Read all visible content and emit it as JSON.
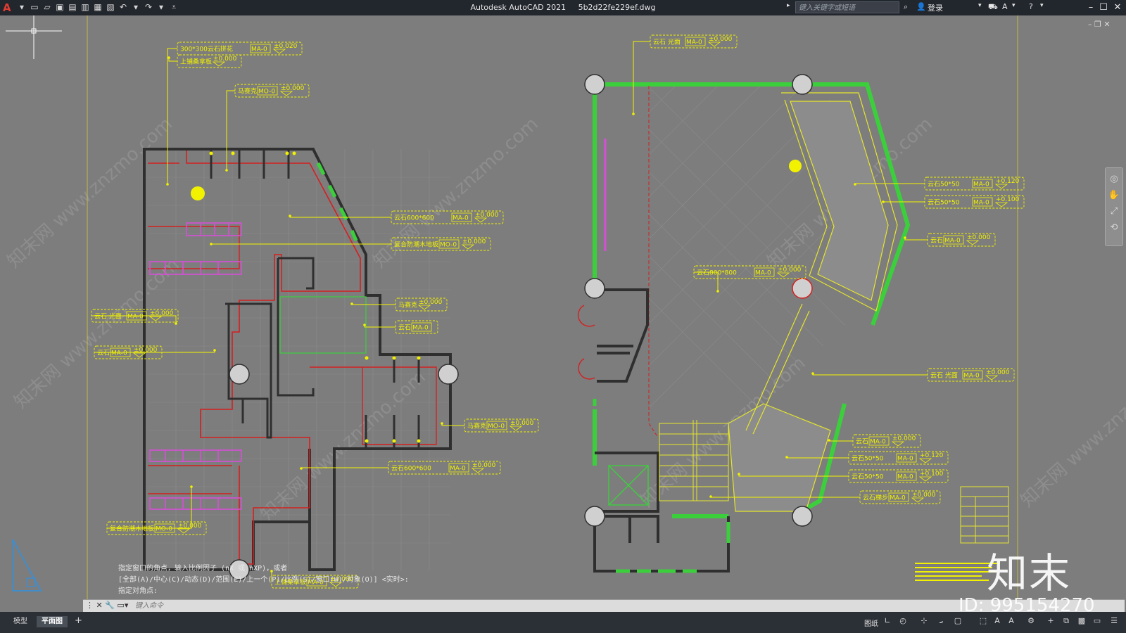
{
  "titlebar": {
    "app_name": "Autodesk AutoCAD 2021",
    "file_name": "5b2d22fe229ef.dwg",
    "search_placeholder": "键入关键字或短语",
    "login_label": "登录",
    "help_label": "?"
  },
  "command": {
    "history": [
      "指定窗口的角点，输入比例因子 (nX 或 nXP)，或者",
      "[全部(A)/中心(C)/动态(D)/范围(E)/上一个(P)/比例(S)/窗口(W)/对象(O)] <实时>:",
      "指定对角点:"
    ],
    "input_placeholder": "键入命令"
  },
  "status": {
    "tabs": [
      "模型",
      "平面图"
    ],
    "active_tab": "平面图",
    "add_tab": "+",
    "paper_label": "图纸"
  },
  "annotations": {
    "left": [
      {
        "text": "300*300云石拼花",
        "tag": "MA-0",
        "level": "±0.020"
      },
      {
        "text": "上铺桑拿板",
        "tag": "",
        "level": "±0.000"
      },
      {
        "text": "马赛克",
        "tag": "MO-0",
        "level": "±0.000"
      },
      {
        "text": "云石600*600",
        "tag": "MA-0",
        "level": "±0.000"
      },
      {
        "text": "复合防潮木地板",
        "tag": "MO-0",
        "level": "±0.000"
      },
      {
        "text": "马赛克",
        "tag": "",
        "level": "±0.000"
      },
      {
        "text": "云石",
        "tag": "MA-0",
        "level": ""
      },
      {
        "text": "云石 光面",
        "tag": "MA-0",
        "level": "±0.000"
      },
      {
        "text": "云石",
        "tag": "MA-0",
        "level": "±0.000"
      },
      {
        "text": "马赛克",
        "tag": "MO-0",
        "level": "±0.000"
      },
      {
        "text": "云石600*600",
        "tag": "MA-0",
        "level": "±0.000"
      },
      {
        "text": "复合防潮木地板",
        "tag": "MO-0",
        "level": "±0.000"
      },
      {
        "text": "上铺桑拿板",
        "tag": "MA-0",
        "level": "±0.000"
      }
    ],
    "right": [
      {
        "text": "云石 光面",
        "tag": "MA-0",
        "level": "±0.000"
      },
      {
        "text": "云石50*50",
        "tag": "MA-0",
        "level": "+0.120"
      },
      {
        "text": "云石50*50",
        "tag": "MA-0",
        "level": "+0.100"
      },
      {
        "text": "云石",
        "tag": "MA-0",
        "level": "±0.000"
      },
      {
        "text": "云石800*800",
        "tag": "MA-0",
        "level": "±0.000"
      },
      {
        "text": "云石 光面",
        "tag": "MA-0",
        "level": "±0.000"
      },
      {
        "text": "云石",
        "tag": "MA-0",
        "level": "±0.000"
      },
      {
        "text": "云石50*50",
        "tag": "MA-0",
        "level": "+0.120"
      },
      {
        "text": "云石50*50",
        "tag": "MA-0",
        "level": "+0.100"
      },
      {
        "text": "云石梯步",
        "tag": "MA-0",
        "level": "±0.000"
      }
    ]
  },
  "watermark": {
    "site": "www.znzmo.com",
    "brand": "知末网",
    "mark": "知末",
    "id": "ID: 995154270"
  },
  "colors": {
    "background": "#7d7d7d",
    "wall": "#3a3a3a",
    "red_line": "#d42020",
    "green_line": "#3ccf3c",
    "magenta_line": "#d64fd6",
    "annotation": "#f2f200"
  }
}
